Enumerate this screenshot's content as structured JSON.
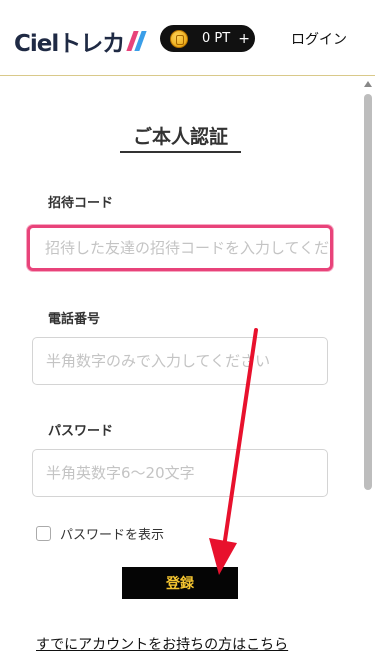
{
  "header": {
    "logo_text": "Cielトレカ",
    "logo_slash_colors": [
      "#e8437a",
      "#3a9ee8"
    ],
    "points_label": "0 PT",
    "points_add": "+",
    "login_label": "ログイン"
  },
  "page": {
    "title": "ご本人認証"
  },
  "form": {
    "invite_label": "招待コード",
    "invite_placeholder": "招待した友達の招待コードを入力してください",
    "phone_label": "電話番号",
    "phone_placeholder": "半角数字のみで入力してください",
    "password_label": "パスワード",
    "password_placeholder": "半角英数字6〜20文字",
    "show_password_label": "パスワードを表示",
    "submit_label": "登録"
  },
  "footer": {
    "account_link": "すでにアカウントをお持ちの方はこちら"
  },
  "colors": {
    "accent_pink": "#e8437a",
    "submit_bg": "#050505",
    "submit_text": "#f4c430",
    "annotation_arrow": "#e8112d"
  }
}
